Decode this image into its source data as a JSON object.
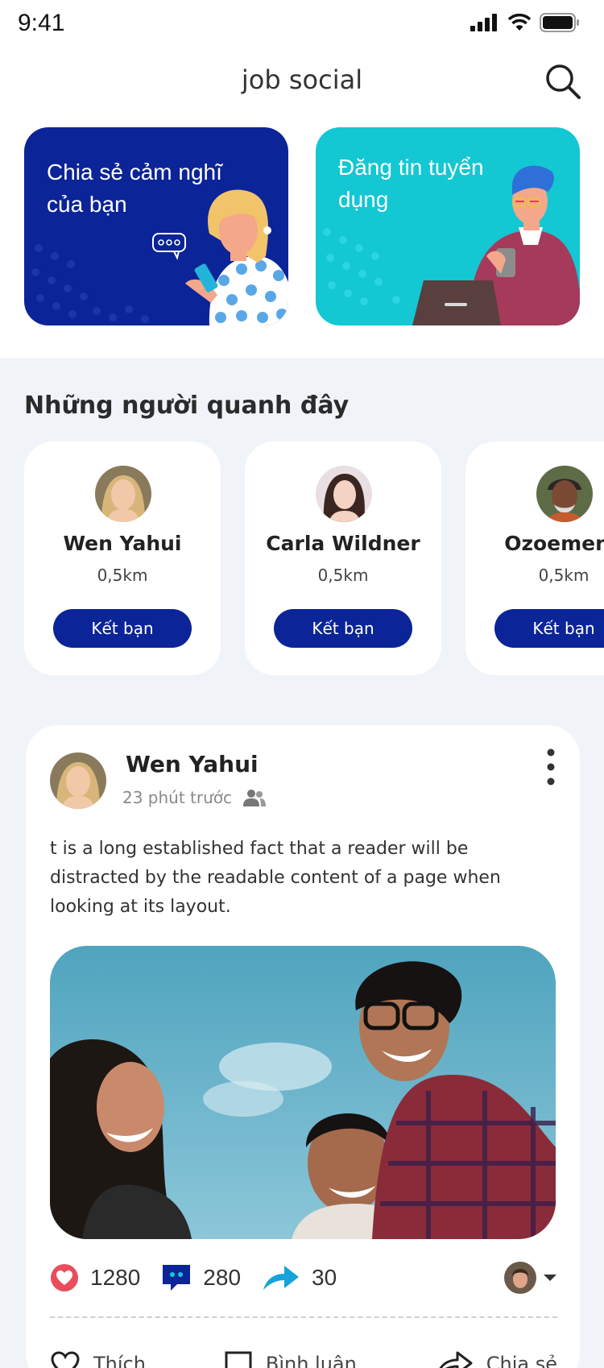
{
  "status_bar": {
    "time": "9:41"
  },
  "header": {
    "title": "job social"
  },
  "banners": [
    {
      "text": "Chia sẻ cảm nghĩ của bạn"
    },
    {
      "text": "Đăng tin tuyển dụng"
    }
  ],
  "nearby": {
    "title": "Những người quanh đây",
    "people": [
      {
        "name": "Wen Yahui",
        "distance": "0,5km",
        "button": "Kết bạn"
      },
      {
        "name": "Carla Wildner",
        "distance": "0,5km",
        "button": "Kết bạn"
      },
      {
        "name": "Ozoemena",
        "distance": "0,5km",
        "button": "Kết bạn"
      }
    ]
  },
  "post": {
    "author": "Wen Yahui",
    "time": "23 phút trước",
    "content": "t is a long established fact that a reader will be distracted by the readable content of a page when looking at its layout.",
    "stats": {
      "likes": "1280",
      "comments": "280",
      "shares": "30"
    },
    "actions": {
      "like": "Thích",
      "comment": "Bình luận",
      "share": "Chia sẻ"
    }
  },
  "colors": {
    "primary": "#0b2497",
    "teal": "#13c7d3",
    "background": "#f0f4f8"
  }
}
